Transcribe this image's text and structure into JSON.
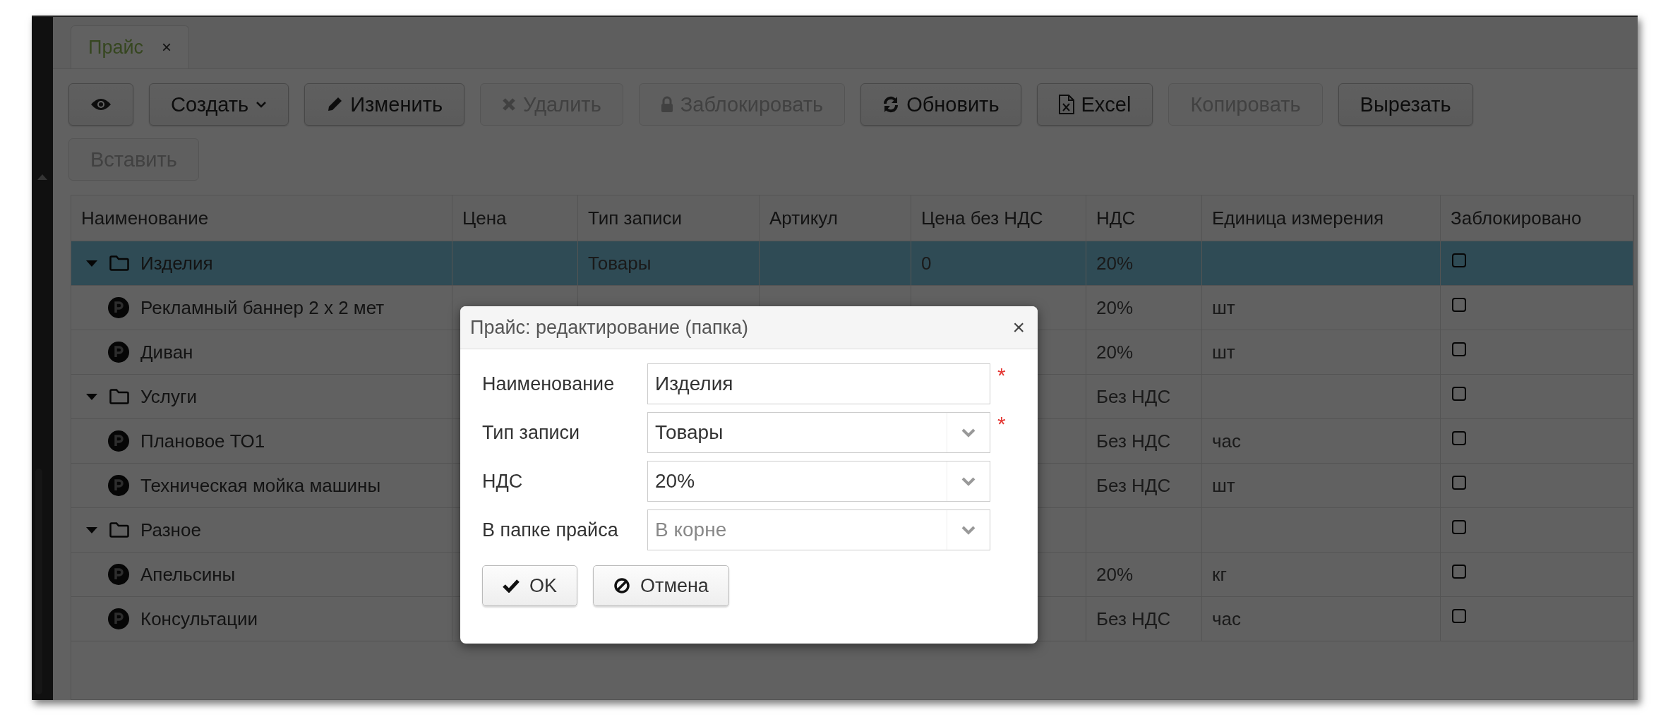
{
  "tab": {
    "label": "Прайс",
    "close": "×",
    "selected": true
  },
  "toolbar": [
    {
      "kind": "eye",
      "disabled": false
    },
    {
      "label": "Создать",
      "kind": "caret",
      "disabled": false
    },
    {
      "label": "Изменить",
      "kind": "pencil",
      "disabled": false
    },
    {
      "label": "Удалить",
      "kind": "cross",
      "disabled": true
    },
    {
      "label": "Заблокировать",
      "kind": "lock",
      "disabled": true
    },
    {
      "label": "Обновить",
      "kind": "refresh",
      "disabled": false
    },
    {
      "label": "Excel",
      "kind": "excel",
      "disabled": false
    },
    {
      "label": "Копировать",
      "disabled": true
    },
    {
      "label": "Вырезать",
      "disabled": false
    },
    {
      "label": "Вставить",
      "disabled": true
    }
  ],
  "table": {
    "columns": [
      "Наименование",
      "Цена",
      "Тип записи",
      "Артикул",
      "Цена без НДС",
      "НДС",
      "Единица измерения",
      "Заблокировано"
    ],
    "rows": [
      {
        "kind": "folder",
        "name": "Изделия",
        "type": "Товары",
        "price_no_vat": "0",
        "vat": "20%",
        "blocked": false,
        "selected": true,
        "expanded": true,
        "children": [
          {
            "kind": "item",
            "name": "Рекламный баннер 2 х 2 мет",
            "vat": "20%",
            "unit": "шт",
            "blocked": false,
            "selected": false
          },
          {
            "kind": "item",
            "name": "Диван",
            "vat": "20%",
            "unit": "шт",
            "blocked": false,
            "selected": false
          }
        ]
      },
      {
        "kind": "folder",
        "name": "Услуги",
        "vat": "Без НДС",
        "blocked": false,
        "selected": false,
        "expanded": true,
        "children": [
          {
            "kind": "item",
            "name": "Плановое ТО1",
            "vat": "Без НДС",
            "unit": "час",
            "blocked": false,
            "selected": false
          },
          {
            "kind": "item",
            "name": "Техническая мойка машины",
            "vat": "Без НДС",
            "unit": "шт",
            "blocked": false,
            "selected": false
          }
        ]
      },
      {
        "kind": "folder",
        "name": "Разное",
        "blocked": false,
        "selected": false,
        "expanded": true,
        "children": [
          {
            "kind": "item",
            "name": "Апельсины",
            "vat": "20%",
            "unit": "кг",
            "blocked": false,
            "selected": false
          },
          {
            "kind": "item",
            "name": "Консультации",
            "vat": "Без НДС",
            "unit": "час",
            "blocked": false,
            "selected": false
          }
        ]
      }
    ]
  },
  "dialog": {
    "title": "Прайс: редактирование (папка)",
    "close": "×",
    "fields": [
      {
        "label": "Наименование",
        "kind": "text",
        "value": "Изделия",
        "required": true
      },
      {
        "label": "Тип записи",
        "kind": "select",
        "value": "Товары",
        "required": true
      },
      {
        "label": "НДС",
        "kind": "select",
        "value": "20%",
        "required": false
      },
      {
        "label": "В папке прайса",
        "kind": "select",
        "placeholder": "В корне",
        "required": false
      }
    ],
    "required_mark": "*",
    "buttons": [
      {
        "label": "OK",
        "kind": "check"
      },
      {
        "label": "Отмена",
        "kind": "ban"
      }
    ]
  }
}
